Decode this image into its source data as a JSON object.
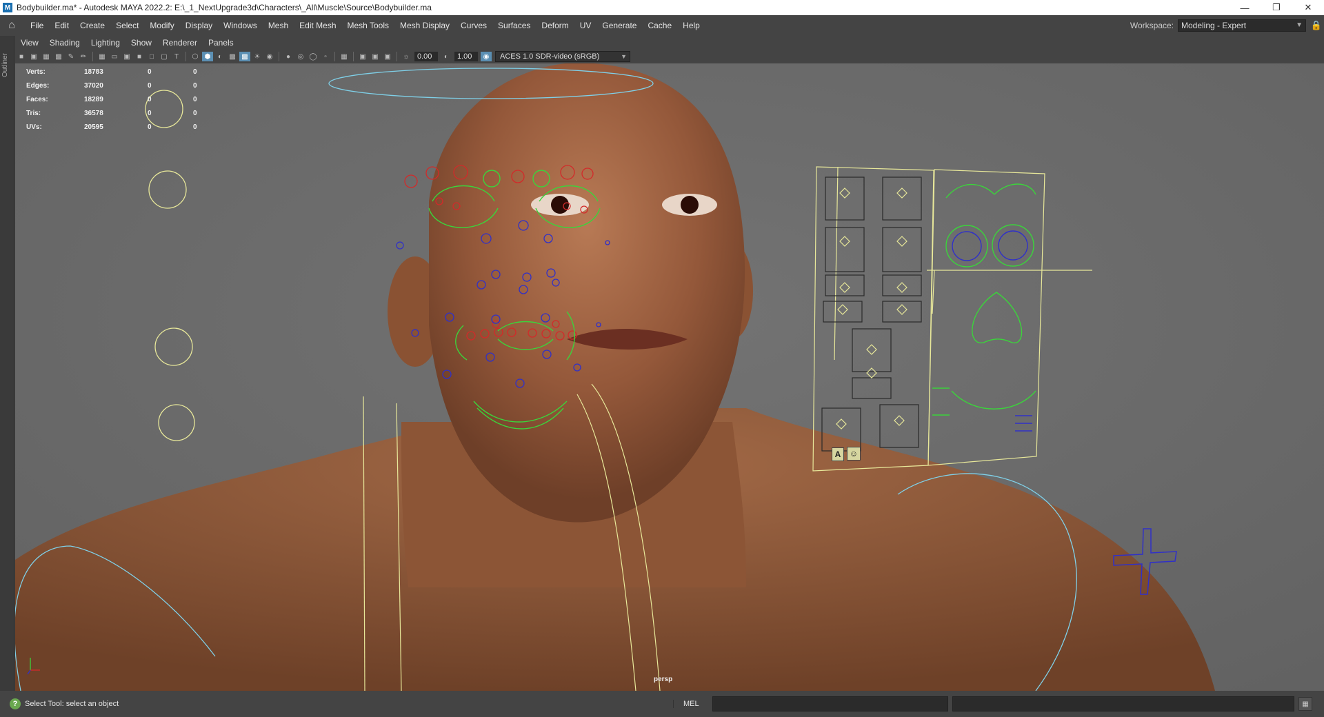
{
  "window": {
    "title": "Bodybuilder.ma* - Autodesk MAYA 2022.2: E:\\_1_NextUpgrade3d\\Characters\\_All\\Muscle\\Source\\Bodybuilder.ma",
    "app_icon": "M"
  },
  "menu": {
    "items": [
      "File",
      "Edit",
      "Create",
      "Select",
      "Modify",
      "Display",
      "Windows",
      "Mesh",
      "Edit Mesh",
      "Mesh Tools",
      "Mesh Display",
      "Curves",
      "Surfaces",
      "Deform",
      "UV",
      "Generate",
      "Cache",
      "Help"
    ]
  },
  "workspace": {
    "label": "Workspace:",
    "value": "Modeling - Expert"
  },
  "outliner_label": "Outliner",
  "panel_menu": {
    "items": [
      "View",
      "Shading",
      "Lighting",
      "Show",
      "Renderer",
      "Panels"
    ]
  },
  "vp_toolbar": {
    "exposure": "0.00",
    "gamma": "1.00",
    "color_space": "ACES 1.0 SDR-video (sRGB)"
  },
  "hud": {
    "rows": [
      {
        "label": "Verts:",
        "v1": "18783",
        "v2": "0",
        "v3": "0"
      },
      {
        "label": "Edges:",
        "v1": "37020",
        "v2": "0",
        "v3": "0"
      },
      {
        "label": "Faces:",
        "v1": "18289",
        "v2": "0",
        "v3": "0"
      },
      {
        "label": "Tris:",
        "v1": "36578",
        "v2": "0",
        "v3": "0"
      },
      {
        "label": "UVs:",
        "v1": "20595",
        "v2": "0",
        "v3": "0"
      }
    ]
  },
  "camera_label": "persp",
  "face_gui_icons": [
    "A",
    "☺"
  ],
  "status": {
    "message": "Select Tool: select an object",
    "mel_label": "MEL"
  },
  "colors": {
    "skin": "#9a5f3c",
    "viewport_bg": "#6d6d6d",
    "ctrl_yellow": "#e8e89a",
    "ctrl_red": "#d22a2a",
    "ctrl_green": "#3bd43b",
    "ctrl_blue": "#3030c8",
    "ctrl_cyan": "#7fd0e8"
  }
}
